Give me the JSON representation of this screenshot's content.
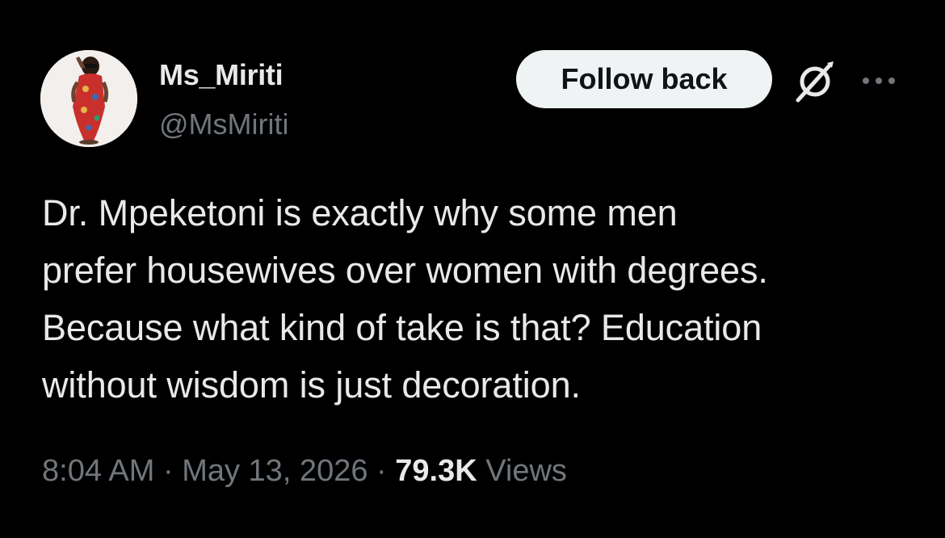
{
  "author": {
    "display_name": "Ms_Miriti",
    "handle": "@MsMiriti"
  },
  "actions": {
    "follow_label": "Follow back",
    "grok_icon": "grok-slash-icon",
    "more_icon": "more-dots-icon"
  },
  "post": {
    "lines": [
      "Dr. Mpeketoni is exactly why some men",
      "prefer housewives over women with degrees.",
      "Because what kind of take is that? Education",
      "without wisdom is just decoration."
    ]
  },
  "meta": {
    "time": "8:04 AM",
    "separator": "·",
    "date": "May 13, 2026",
    "views_count": "79.3K",
    "views_label": "Views"
  },
  "colors": {
    "background": "#000000",
    "primary_text": "#e7e9ea",
    "secondary_text": "#71767b",
    "button_bg": "#eff3f4",
    "button_text": "#0f1419"
  }
}
